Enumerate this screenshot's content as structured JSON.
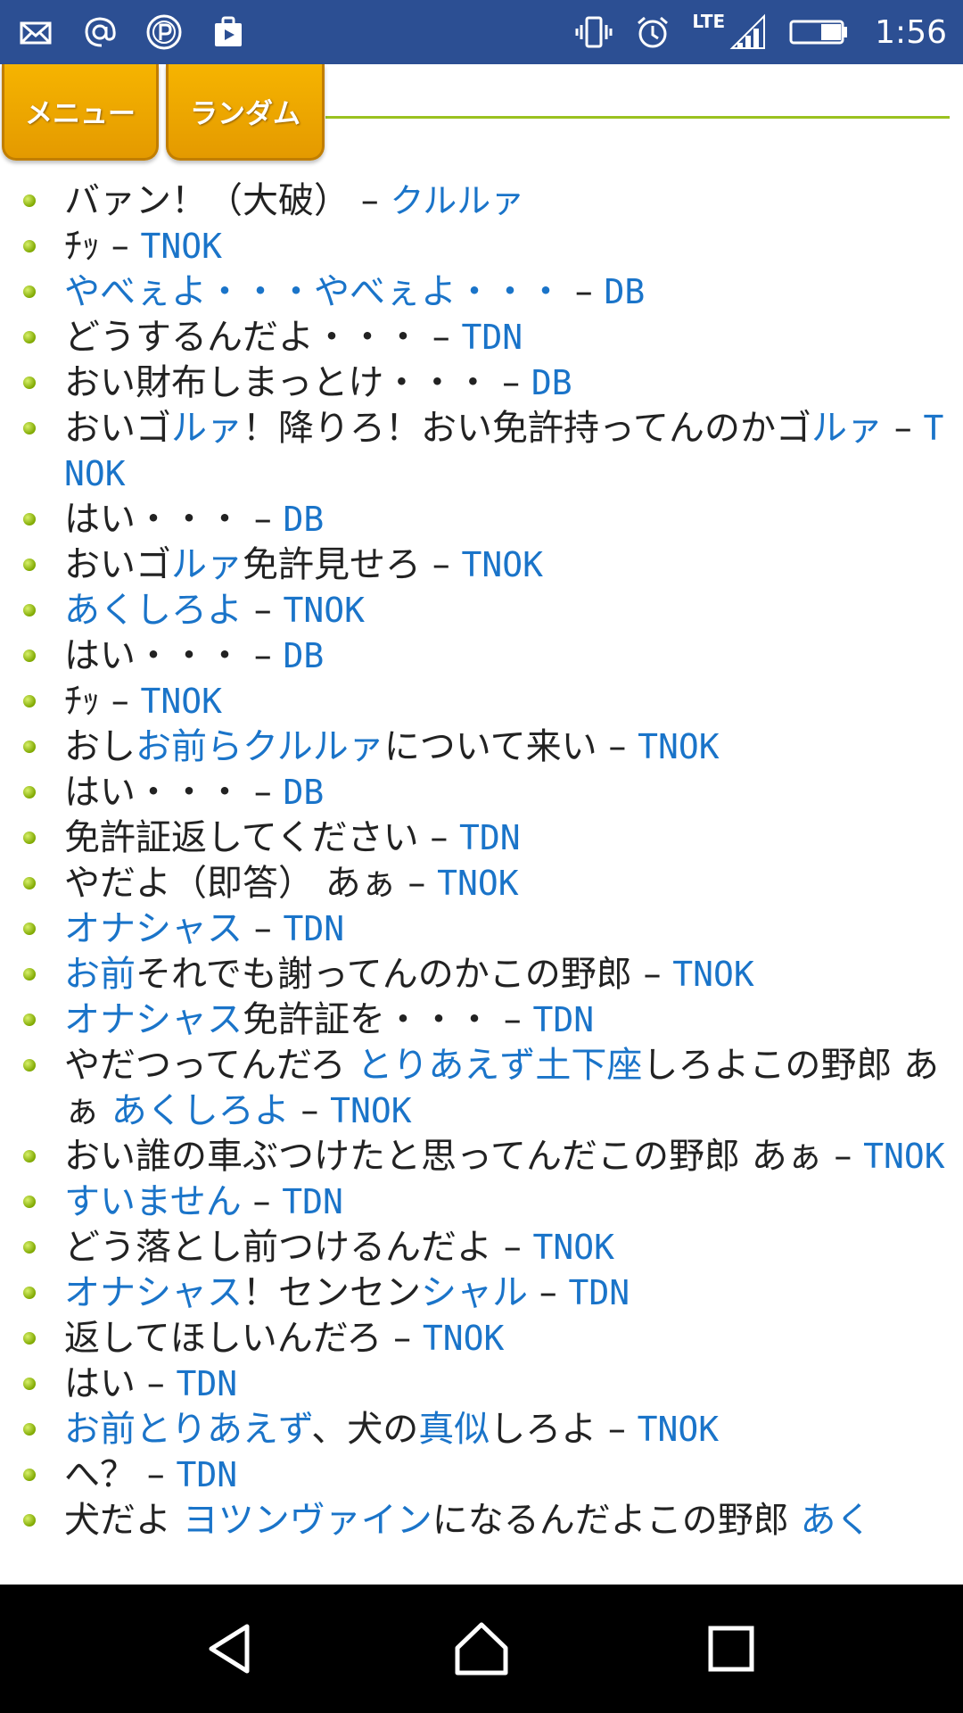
{
  "status": {
    "time": "1:56",
    "network": "LTE",
    "left_icons": [
      "mail-icon",
      "at-sign-icon",
      "p-circle-icon",
      "clipboard-play-icon"
    ],
    "right_icons": [
      "vibrate-icon",
      "alarm-icon",
      "signal-icon",
      "battery-icon"
    ]
  },
  "tabs": {
    "menu": "メニュー",
    "random": "ランダム"
  },
  "colors": {
    "status_bar": "#2c4f93",
    "tab": "#f0a800",
    "link": "#1a74c9",
    "rule": "#9ac21f"
  },
  "lines": [
    {
      "segments": [
        {
          "t": "バァン！（大破）",
          "blue": false
        }
      ],
      "speaker": "クルルァ"
    },
    {
      "segments": [
        {
          "t": "ﾁｯ",
          "blue": false
        }
      ],
      "speaker": "TNOK"
    },
    {
      "segments": [
        {
          "t": "やべぇよ・・・やべぇよ・・・",
          "blue": true
        }
      ],
      "speaker": "DB"
    },
    {
      "segments": [
        {
          "t": "どうするんだよ・・・",
          "blue": false
        }
      ],
      "speaker": "TDN"
    },
    {
      "segments": [
        {
          "t": "おい財布しまっとけ・・・",
          "blue": false
        }
      ],
      "speaker": "DB"
    },
    {
      "segments": [
        {
          "t": "おいゴ",
          "blue": false
        },
        {
          "t": "ルァ",
          "blue": true
        },
        {
          "t": "！降りろ！おい免許持ってんのかゴ",
          "blue": false
        },
        {
          "t": "ルァ",
          "blue": true
        }
      ],
      "speaker": "TNOK"
    },
    {
      "segments": [
        {
          "t": "はい・・・",
          "blue": false
        }
      ],
      "speaker": "DB"
    },
    {
      "segments": [
        {
          "t": "おいゴ",
          "blue": false
        },
        {
          "t": "ルァ",
          "blue": true
        },
        {
          "t": "免許見せろ",
          "blue": false
        }
      ],
      "speaker": "TNOK"
    },
    {
      "segments": [
        {
          "t": "あくしろよ",
          "blue": true
        }
      ],
      "speaker": "TNOK"
    },
    {
      "segments": [
        {
          "t": "はい・・・",
          "blue": false
        }
      ],
      "speaker": "DB"
    },
    {
      "segments": [
        {
          "t": "ﾁｯ",
          "blue": false
        }
      ],
      "speaker": "TNOK"
    },
    {
      "segments": [
        {
          "t": "おし",
          "blue": false
        },
        {
          "t": "お前らクルルァ",
          "blue": true
        },
        {
          "t": "について来い",
          "blue": false
        }
      ],
      "speaker": "TNOK"
    },
    {
      "segments": [
        {
          "t": "はい・・・",
          "blue": false
        }
      ],
      "speaker": "DB"
    },
    {
      "segments": [
        {
          "t": "免許証返してください",
          "blue": false
        }
      ],
      "speaker": "TDN"
    },
    {
      "segments": [
        {
          "t": "やだよ（即答） あぁ",
          "blue": false
        }
      ],
      "speaker": "TNOK"
    },
    {
      "segments": [
        {
          "t": "オナシャス",
          "blue": true
        }
      ],
      "speaker": "TDN"
    },
    {
      "segments": [
        {
          "t": "お前",
          "blue": true
        },
        {
          "t": "それでも謝ってんのかこの野郎",
          "blue": false
        }
      ],
      "speaker": "TNOK"
    },
    {
      "segments": [
        {
          "t": "オナシャス",
          "blue": true
        },
        {
          "t": "免許証を・・・",
          "blue": false
        }
      ],
      "speaker": "TDN"
    },
    {
      "segments": [
        {
          "t": "やだつってんだろ ",
          "blue": false
        },
        {
          "t": "とりあえず土下座",
          "blue": true
        },
        {
          "t": "しろよこの野郎 あぁ ",
          "blue": false
        },
        {
          "t": "あくしろよ",
          "blue": true
        }
      ],
      "speaker": "TNOK"
    },
    {
      "segments": [
        {
          "t": "おい誰の車ぶつけたと思ってんだこの野郎 あぁ",
          "blue": false
        }
      ],
      "speaker": "TNOK"
    },
    {
      "segments": [
        {
          "t": "すいません",
          "blue": true
        }
      ],
      "speaker": "TDN"
    },
    {
      "segments": [
        {
          "t": "どう落とし前つけるんだよ",
          "blue": false
        }
      ],
      "speaker": "TNOK"
    },
    {
      "segments": [
        {
          "t": "オナシャス",
          "blue": true
        },
        {
          "t": "！センセン",
          "blue": false
        },
        {
          "t": "シャル",
          "blue": true
        }
      ],
      "speaker": "TDN"
    },
    {
      "segments": [
        {
          "t": "返してほしいんだろ",
          "blue": false
        }
      ],
      "speaker": "TNOK"
    },
    {
      "segments": [
        {
          "t": "はい",
          "blue": false
        }
      ],
      "speaker": "TDN"
    },
    {
      "segments": [
        {
          "t": "お前とりあえず",
          "blue": true
        },
        {
          "t": "、犬の",
          "blue": false
        },
        {
          "t": "真似",
          "blue": true
        },
        {
          "t": "しろよ",
          "blue": false
        }
      ],
      "speaker": "TNOK"
    },
    {
      "segments": [
        {
          "t": "へ？",
          "blue": false
        }
      ],
      "speaker": "TDN"
    },
    {
      "segments": [
        {
          "t": "犬だよ ",
          "blue": false
        },
        {
          "t": "ヨツンヴァイン",
          "blue": true
        },
        {
          "t": "になるんだよこの野郎 ",
          "blue": false
        },
        {
          "t": "あく",
          "blue": true
        }
      ],
      "speaker": ""
    }
  ]
}
